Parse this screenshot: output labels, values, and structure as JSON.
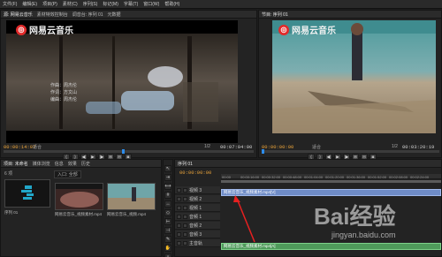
{
  "menu": [
    "文件(F)",
    "编辑(E)",
    "项目(P)",
    "素材(C)",
    "序列(S)",
    "标记(M)",
    "字幕(T)",
    "窗口(W)",
    "帮助(H)"
  ],
  "source_panel": {
    "tabs": [
      "源: 网易云音乐",
      "素材特效控制台",
      "调音台: 序列 01",
      "元数据"
    ],
    "watermark": "网易云音乐",
    "caption_lines": [
      "作曲：周杰伦",
      "作词：方文山",
      "编曲：周杰伦"
    ],
    "timecode_left": "00:00:14:07",
    "fit": "适合",
    "timecode_right": "00:07:04:00",
    "fraction": "1/2"
  },
  "program_panel": {
    "tabs": [
      "节目: 序列 01"
    ],
    "watermark": "网易云音乐",
    "timecode_left": "00:00:00:00",
    "fit": "适合",
    "timecode_right": "00:03:20:19",
    "fraction": "1/2"
  },
  "project_panel": {
    "tabs": [
      "项目: 未命名",
      "媒体浏览",
      "信息",
      "效果",
      "历史"
    ],
    "search_placeholder": "入口: 全部",
    "items_count": "6 项",
    "sequence_label": "序列 01",
    "clip1_label": "网易云音乐_视频素材.mp4",
    "clip2_label": "网易云音乐_视频.mp4"
  },
  "timeline": {
    "tabs": [
      "序列 01"
    ],
    "timecode": "00:00:00:00",
    "ruler": [
      "00:00",
      "00:00:16:00",
      "00:00:32:00",
      "00:00:48:00",
      "00:01:04:00",
      "00:01:20:00",
      "00:01:36:00",
      "00:01:52:00",
      "00:02:08:00",
      "00:02:24:00",
      "00:02:40:00"
    ],
    "tracks": [
      "视频 3",
      "视频 2",
      "视频 1",
      "音频 1",
      "音频 2",
      "音频 3",
      "主音轨"
    ],
    "video_clip": "网易云音乐_视频素材.mp4[V]",
    "audio_clip": "网易云音乐_视频素材.mp4[A]"
  },
  "watermark_bottom": {
    "brand": "Bai经验",
    "url": "jingyan.baidu.com"
  },
  "colors": {
    "timecode": "#e9a33b",
    "clip_video": "#6f8cc7",
    "clip_audio": "#4f9b5b",
    "annotation_arrow": "#e62020"
  }
}
